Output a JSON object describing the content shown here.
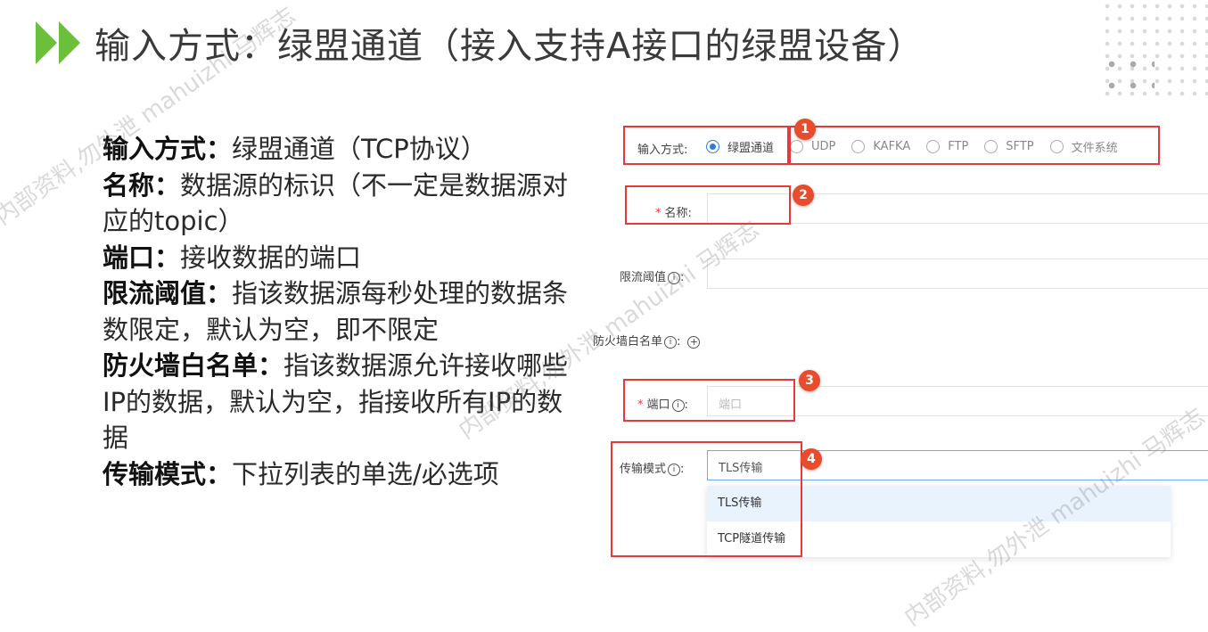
{
  "slide": {
    "title": "输入方式：绿盟通道（接入支持A接口的绿盟设备）"
  },
  "description": [
    {
      "term": "输入方式：",
      "text": "绿盟通道（TCP协议）"
    },
    {
      "term": "名称：",
      "text": "数据源的标识（不一定是数据源对应的topic）"
    },
    {
      "term": "端口：",
      "text": "接收数据的端口"
    },
    {
      "term": "限流阈值：",
      "text": "指该数据源每秒处理的数据条数限定，默认为空，即不限定"
    },
    {
      "term": "防火墙白名单：",
      "text": "指该数据源允许接收哪些IP的数据，默认为空，指接收所有IP的数据"
    },
    {
      "term": "传输模式：",
      "text": "下拉列表的单选/必选项"
    }
  ],
  "form": {
    "input_method_label": "输入方式:",
    "input_options": [
      "绿盟通道",
      "UDP",
      "KAFKA",
      "FTP",
      "SFTP",
      "文件系统"
    ],
    "name_label": "名称:",
    "rate_limit_label": "限流阈值",
    "whitelist_label": "防火墙白名单",
    "port_label": "端口",
    "port_placeholder": "端口",
    "transfer_mode_label": "传输模式",
    "transfer_mode_value": "TLS传输",
    "transfer_mode_options": [
      "TLS传输",
      "TCP隧道传输"
    ],
    "info_glyph": "i",
    "colon": ":",
    "plus_glyph": "+"
  },
  "badges": [
    "1",
    "2",
    "3",
    "4"
  ],
  "watermark": "内部资料,勿外泄 mahuizhi 马辉志",
  "colors": {
    "accent_green": "#6bbf3a",
    "annotation_red": "#e5393b",
    "radio_blue": "#2b7de1"
  }
}
